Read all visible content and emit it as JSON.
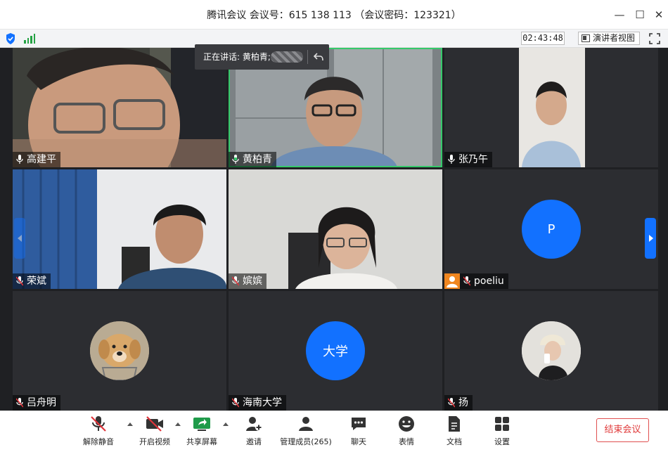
{
  "window": {
    "title": "腾讯会议 会议号：615 138 113 （会议密码：123321）",
    "controls": {
      "minimize": "—",
      "maximize": "☐",
      "close": "✕"
    }
  },
  "status": {
    "timer": "02:43:48",
    "speaker_view_label": "演讲者视图",
    "network_icon": "signal-bars-icon",
    "security_icon": "shield-icon"
  },
  "speaking": {
    "label": "正在讲话: 黄柏青;"
  },
  "participants": [
    {
      "name": "高建平",
      "mic": "on",
      "kind": "video"
    },
    {
      "name": "黄柏青",
      "mic": "active",
      "kind": "video"
    },
    {
      "name": "张乃午",
      "mic": "on",
      "kind": "video"
    },
    {
      "name": "荣斌",
      "mic": "muted",
      "kind": "video"
    },
    {
      "name": "嫔嫔",
      "mic": "muted",
      "kind": "video"
    },
    {
      "name": "poeliu",
      "mic": "muted",
      "kind": "avatar",
      "avatar_text": "P"
    },
    {
      "name": "吕舟明",
      "mic": "muted",
      "kind": "photo"
    },
    {
      "name": "海南大学",
      "mic": "muted",
      "kind": "avatar",
      "avatar_text": "大学"
    },
    {
      "name": "扬",
      "mic": "muted",
      "kind": "photo"
    }
  ],
  "toolbar": {
    "unmute": "解除静音",
    "start_video": "开启视频",
    "share_screen": "共享屏幕",
    "invite": "邀请",
    "manage_members": "管理成员(265)",
    "chat": "聊天",
    "reactions": "表情",
    "docs": "文档",
    "settings": "设置",
    "end_meeting": "结束会议"
  },
  "colors": {
    "accent": "#1271ff",
    "speaking_green": "#35c96a",
    "mute_red": "#e0343a",
    "end_red": "#e03a3a"
  }
}
